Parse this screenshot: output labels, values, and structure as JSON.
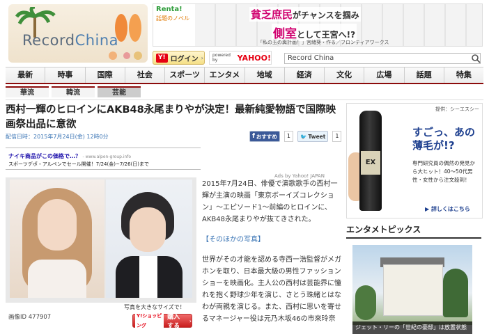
{
  "header": {
    "logo_text_a": "Record",
    "logo_text_b": "China",
    "login_label": "ログイン",
    "powered_by": "powered by",
    "yahoo_brand": "YAHOO!",
    "search_value": "Record China"
  },
  "banner_ad": {
    "rental_brand": "Renta!",
    "rental_sub": "話題のノベル",
    "headline_1a": "貧乏庶民",
    "headline_1b": "がチャンスを掴み",
    "headline_2a": "側室",
    "headline_2b": "として王宮へ!?",
    "credit": "「私の玉の輿計画！」宮緒葵・作る／フロンティアワークス"
  },
  "nav": {
    "items": [
      "最新",
      "時事",
      "国際",
      "社会",
      "スポーツ",
      "エンタメ",
      "地域",
      "経済",
      "文化",
      "広場",
      "話題",
      "特集"
    ]
  },
  "subnav": {
    "items": [
      "華流",
      "韓流",
      "芸能"
    ],
    "active": "芸能"
  },
  "article": {
    "title": "西村一輝のヒロインにAKB48永尾まりやが決定！最新純愛物語で国際映画祭出品に意欲",
    "date": "配信日時：2015年7月24日(金) 12時0分",
    "share_fb": "おすすめ",
    "share_fb_count": "1",
    "share_tw": "Tweet",
    "share_tw_count": "1",
    "image_caption": "写真を大きなサイズで！",
    "image_id": "画像ID 477907",
    "buy_label": "購入する",
    "yahoo_shopping": "Y!ショッピング",
    "para1": "2015年7月24日、俳優で演歌歌手の西村一輝が主演の映画「東京ボーイズコレクション」～エピソード1～前編のヒロインに、AKB48永尾まりやが抜てきされた。",
    "more_photos": "【そのほかの写真】",
    "para2": "世界がその才能を認める寺西一浩監督がメガホンを取り、日本最大級の男性ファッションショーを映画化。主人公の西村は芸能界に憧れを抱く野球少年を演じ、さとう珠緒とはなわが両親を演じる。また、西村に思いを寄せるマネージャー役は元乃木坂46の市來玲奈"
  },
  "inline_ad": {
    "title": "ナイキ商品がこの価格で…？",
    "domain": "- www.alpen-group.info",
    "desc": "スポーツデポ・アルペンでセール開催！7/24(金)~7/26(日)まで",
    "ads_by": "Ads by Yahoo! JAPAN"
  },
  "side_ad": {
    "provider": "提供：シーエスシー",
    "bottle_label": "EX",
    "headline": "すごっ、あの薄毛が!?",
    "desc": "専門研究員の偶然の発見から大ヒット！40～50代男性・女性から注文殺到！",
    "detail_link": "▶ 詳しくはこちら"
  },
  "entertainment": {
    "title": "エンタメトピックス",
    "caption": "ジェット・リーの「世紀の豪邸」は放置状態"
  }
}
